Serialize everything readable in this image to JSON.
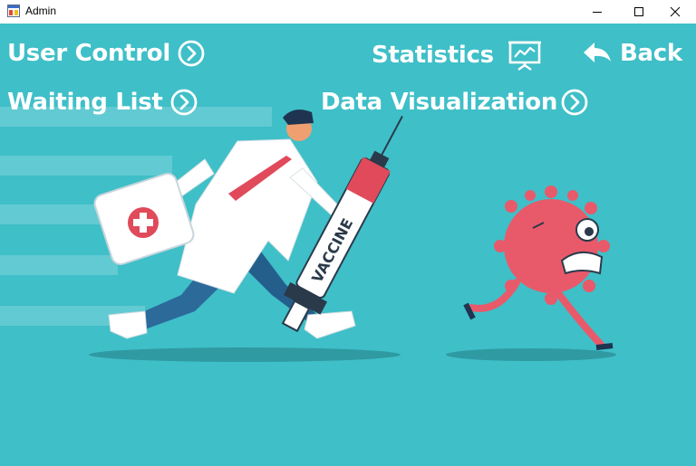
{
  "window": {
    "title": "Admin",
    "icon": "app-window-icon",
    "controls": [
      "minimize-icon",
      "maximize-icon",
      "close-icon"
    ]
  },
  "nav": {
    "user_control": "User Control",
    "waiting_list": "Waiting List",
    "statistics": "Statistics",
    "data_visualization": "Data Visualization",
    "back": "Back"
  },
  "illustration": {
    "syringe_label": "VACCINE"
  },
  "colors": {
    "background": "#3fbfc8",
    "text": "#ffffff",
    "virus": "#e85a6a",
    "coat": "#ffffff",
    "pants": "#2c6a9a"
  }
}
